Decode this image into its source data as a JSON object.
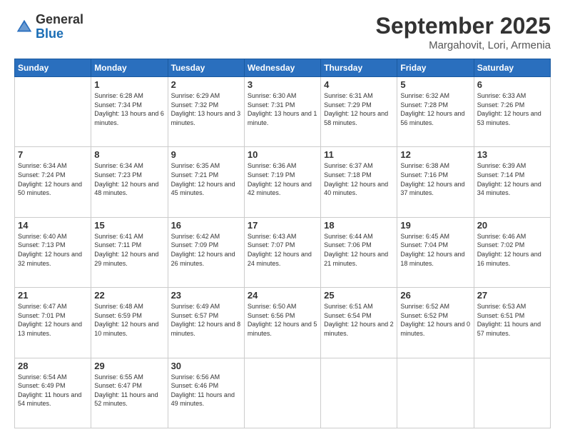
{
  "logo": {
    "general": "General",
    "blue": "Blue"
  },
  "header": {
    "month": "September 2025",
    "location": "Margahovit, Lori, Armenia"
  },
  "weekdays": [
    "Sunday",
    "Monday",
    "Tuesday",
    "Wednesday",
    "Thursday",
    "Friday",
    "Saturday"
  ],
  "weeks": [
    [
      {
        "day": "",
        "sunrise": "",
        "sunset": "",
        "daylight": ""
      },
      {
        "day": "1",
        "sunrise": "Sunrise: 6:28 AM",
        "sunset": "Sunset: 7:34 PM",
        "daylight": "Daylight: 13 hours and 6 minutes."
      },
      {
        "day": "2",
        "sunrise": "Sunrise: 6:29 AM",
        "sunset": "Sunset: 7:32 PM",
        "daylight": "Daylight: 13 hours and 3 minutes."
      },
      {
        "day": "3",
        "sunrise": "Sunrise: 6:30 AM",
        "sunset": "Sunset: 7:31 PM",
        "daylight": "Daylight: 13 hours and 1 minute."
      },
      {
        "day": "4",
        "sunrise": "Sunrise: 6:31 AM",
        "sunset": "Sunset: 7:29 PM",
        "daylight": "Daylight: 12 hours and 58 minutes."
      },
      {
        "day": "5",
        "sunrise": "Sunrise: 6:32 AM",
        "sunset": "Sunset: 7:28 PM",
        "daylight": "Daylight: 12 hours and 56 minutes."
      },
      {
        "day": "6",
        "sunrise": "Sunrise: 6:33 AM",
        "sunset": "Sunset: 7:26 PM",
        "daylight": "Daylight: 12 hours and 53 minutes."
      }
    ],
    [
      {
        "day": "7",
        "sunrise": "Sunrise: 6:34 AM",
        "sunset": "Sunset: 7:24 PM",
        "daylight": "Daylight: 12 hours and 50 minutes."
      },
      {
        "day": "8",
        "sunrise": "Sunrise: 6:34 AM",
        "sunset": "Sunset: 7:23 PM",
        "daylight": "Daylight: 12 hours and 48 minutes."
      },
      {
        "day": "9",
        "sunrise": "Sunrise: 6:35 AM",
        "sunset": "Sunset: 7:21 PM",
        "daylight": "Daylight: 12 hours and 45 minutes."
      },
      {
        "day": "10",
        "sunrise": "Sunrise: 6:36 AM",
        "sunset": "Sunset: 7:19 PM",
        "daylight": "Daylight: 12 hours and 42 minutes."
      },
      {
        "day": "11",
        "sunrise": "Sunrise: 6:37 AM",
        "sunset": "Sunset: 7:18 PM",
        "daylight": "Daylight: 12 hours and 40 minutes."
      },
      {
        "day": "12",
        "sunrise": "Sunrise: 6:38 AM",
        "sunset": "Sunset: 7:16 PM",
        "daylight": "Daylight: 12 hours and 37 minutes."
      },
      {
        "day": "13",
        "sunrise": "Sunrise: 6:39 AM",
        "sunset": "Sunset: 7:14 PM",
        "daylight": "Daylight: 12 hours and 34 minutes."
      }
    ],
    [
      {
        "day": "14",
        "sunrise": "Sunrise: 6:40 AM",
        "sunset": "Sunset: 7:13 PM",
        "daylight": "Daylight: 12 hours and 32 minutes."
      },
      {
        "day": "15",
        "sunrise": "Sunrise: 6:41 AM",
        "sunset": "Sunset: 7:11 PM",
        "daylight": "Daylight: 12 hours and 29 minutes."
      },
      {
        "day": "16",
        "sunrise": "Sunrise: 6:42 AM",
        "sunset": "Sunset: 7:09 PM",
        "daylight": "Daylight: 12 hours and 26 minutes."
      },
      {
        "day": "17",
        "sunrise": "Sunrise: 6:43 AM",
        "sunset": "Sunset: 7:07 PM",
        "daylight": "Daylight: 12 hours and 24 minutes."
      },
      {
        "day": "18",
        "sunrise": "Sunrise: 6:44 AM",
        "sunset": "Sunset: 7:06 PM",
        "daylight": "Daylight: 12 hours and 21 minutes."
      },
      {
        "day": "19",
        "sunrise": "Sunrise: 6:45 AM",
        "sunset": "Sunset: 7:04 PM",
        "daylight": "Daylight: 12 hours and 18 minutes."
      },
      {
        "day": "20",
        "sunrise": "Sunrise: 6:46 AM",
        "sunset": "Sunset: 7:02 PM",
        "daylight": "Daylight: 12 hours and 16 minutes."
      }
    ],
    [
      {
        "day": "21",
        "sunrise": "Sunrise: 6:47 AM",
        "sunset": "Sunset: 7:01 PM",
        "daylight": "Daylight: 12 hours and 13 minutes."
      },
      {
        "day": "22",
        "sunrise": "Sunrise: 6:48 AM",
        "sunset": "Sunset: 6:59 PM",
        "daylight": "Daylight: 12 hours and 10 minutes."
      },
      {
        "day": "23",
        "sunrise": "Sunrise: 6:49 AM",
        "sunset": "Sunset: 6:57 PM",
        "daylight": "Daylight: 12 hours and 8 minutes."
      },
      {
        "day": "24",
        "sunrise": "Sunrise: 6:50 AM",
        "sunset": "Sunset: 6:56 PM",
        "daylight": "Daylight: 12 hours and 5 minutes."
      },
      {
        "day": "25",
        "sunrise": "Sunrise: 6:51 AM",
        "sunset": "Sunset: 6:54 PM",
        "daylight": "Daylight: 12 hours and 2 minutes."
      },
      {
        "day": "26",
        "sunrise": "Sunrise: 6:52 AM",
        "sunset": "Sunset: 6:52 PM",
        "daylight": "Daylight: 12 hours and 0 minutes."
      },
      {
        "day": "27",
        "sunrise": "Sunrise: 6:53 AM",
        "sunset": "Sunset: 6:51 PM",
        "daylight": "Daylight: 11 hours and 57 minutes."
      }
    ],
    [
      {
        "day": "28",
        "sunrise": "Sunrise: 6:54 AM",
        "sunset": "Sunset: 6:49 PM",
        "daylight": "Daylight: 11 hours and 54 minutes."
      },
      {
        "day": "29",
        "sunrise": "Sunrise: 6:55 AM",
        "sunset": "Sunset: 6:47 PM",
        "daylight": "Daylight: 11 hours and 52 minutes."
      },
      {
        "day": "30",
        "sunrise": "Sunrise: 6:56 AM",
        "sunset": "Sunset: 6:46 PM",
        "daylight": "Daylight: 11 hours and 49 minutes."
      },
      {
        "day": "",
        "sunrise": "",
        "sunset": "",
        "daylight": ""
      },
      {
        "day": "",
        "sunrise": "",
        "sunset": "",
        "daylight": ""
      },
      {
        "day": "",
        "sunrise": "",
        "sunset": "",
        "daylight": ""
      },
      {
        "day": "",
        "sunrise": "",
        "sunset": "",
        "daylight": ""
      }
    ]
  ]
}
